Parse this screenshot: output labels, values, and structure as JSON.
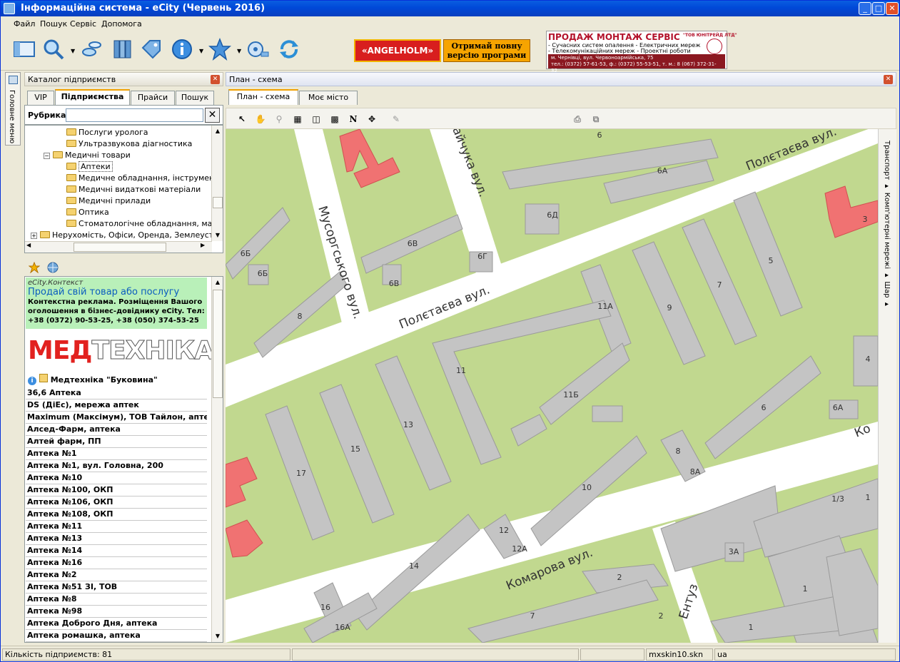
{
  "window": {
    "title": "Інформаційна система - eCity (Червень 2016)"
  },
  "menu": [
    "Файл",
    "Пошук",
    "Сервіс",
    "Допомога"
  ],
  "toolbar": {
    "icons": [
      "layout-icon",
      "search-icon",
      "pills-icon",
      "books-icon",
      "tag-icon",
      "info-icon",
      "star-icon",
      "film-icon",
      "refresh-icon"
    ],
    "ad_angelholm": "«ANGELHOLM»",
    "ad_full_line1": "Отримай повну",
    "ad_full_line2": "версію програми",
    "ad_service": {
      "title": "ПРОДАЖ МОНТАЖ СЕРВІС",
      "company": "\"ТОВ ЮНІТРЕЙД ЛТД\"",
      "line1": "- Сучасних систем опалення - Електричних мереж",
      "line2": "- Телекомунікаційних мереж - Проектні роботи",
      "addr": "м. Чернівці, вул. Червоноармійська, 75",
      "phones": "тел.: (0372) 57-61-53, ф.: (0372) 55-53-51, т. м.: 8 (067) 372-31-32"
    }
  },
  "sidetab": {
    "label": "Головне меню"
  },
  "catalog": {
    "title": "Каталог підприємств",
    "tabs": [
      "VIP",
      "Підприємства",
      "Прайси",
      "Пошук"
    ],
    "rubrika_label": "Рубрика",
    "rubrika_value": "",
    "tree": [
      {
        "label": "Послуги уролога",
        "level": 3
      },
      {
        "label": "Ультразвукова діагностика",
        "level": 3
      },
      {
        "label": "Медичні товари",
        "level": 2,
        "expander": "−"
      },
      {
        "label": "Аптеки",
        "level": 3,
        "selected": true
      },
      {
        "label": "Медичне обладнання, інструмент",
        "level": 3
      },
      {
        "label": "Медичні видаткові матеріали",
        "level": 3
      },
      {
        "label": "Медичні прилади",
        "level": 3
      },
      {
        "label": "Оптика",
        "level": 3
      },
      {
        "label": "Стоматологічне обладнання, матер",
        "level": 3
      },
      {
        "label": "Нерухомість, Офіси, Оренда, Землеустрій",
        "level": 1,
        "expander": "+"
      }
    ],
    "context_ad": {
      "brand": "eCity.Контекст",
      "headline": "Продай свій товар або послугу",
      "body": "Контекстна реклама. Розміщення Вашого оголошення в бізнес-довіднику eCity. Тел: +38 (0372) 90-53-25, +38 (050) 374-53-25"
    },
    "logo_a": "МЕД",
    "logo_b": "ТЕХНІКА",
    "first_item": "Медтехніка \"Буковина\"",
    "items": [
      "36,6 Аптека",
      "DS (ДіЕс), мережа аптек",
      "Maximum (Максімум), ТОВ Тайлон, аптека",
      "Алсед-Фарм, аптека",
      "Алтей фарм, ПП",
      "Аптека №1",
      "Аптека №1, вул. Головна, 200",
      "Аптека №10",
      "Аптека №100, ОКП",
      "Аптека №106, ОКП",
      "Аптека №108, ОКП",
      "Аптека №11",
      "Аптека №13",
      "Аптека №14",
      "Аптека №16",
      "Аптека №2",
      "Аптека №51 ЗІ, ТОВ",
      "Аптека №8",
      "Аптека №98",
      "Аптека Доброго Дня, аптека",
      "Аптека ромашка, аптека"
    ]
  },
  "mappanel": {
    "title": "План - схема",
    "tabs": [
      "План - схема",
      "Моє місто"
    ],
    "right_tabs": "Транспорт ▸  Комп'ютерні мережі ▸  Шар ▸",
    "streets": [
      {
        "name": "Полєтаєва вул.",
        "id": "s1"
      },
      {
        "name": "Полєтаєва вул.",
        "id": "s2"
      },
      {
        "name": "Мусоргського вул.",
        "id": "s3"
      },
      {
        "name": "Комарова вул.",
        "id": "s4"
      },
      {
        "name": "айчука вул.",
        "id": "s5"
      },
      {
        "name": "Ентуз",
        "id": "s6"
      },
      {
        "name": "Ко",
        "id": "s7"
      }
    ],
    "buildings": [
      "6",
      "6А",
      "6Д",
      "6В",
      "6Г",
      "6Б",
      "6Б",
      "6В",
      "8",
      "11А",
      "9",
      "7",
      "5",
      "3",
      "11",
      "11Б",
      "13",
      "15",
      "17",
      "6",
      "6А",
      "4",
      "8",
      "8А",
      "10",
      "12",
      "12А",
      "14",
      "16",
      "16А",
      "7",
      "2",
      "2",
      "3А",
      "1/3",
      "1",
      "1",
      "1"
    ]
  },
  "status": {
    "count": "Кількість підприємств: 81",
    "skin": "mxskin10.skn",
    "lang": "ua"
  }
}
